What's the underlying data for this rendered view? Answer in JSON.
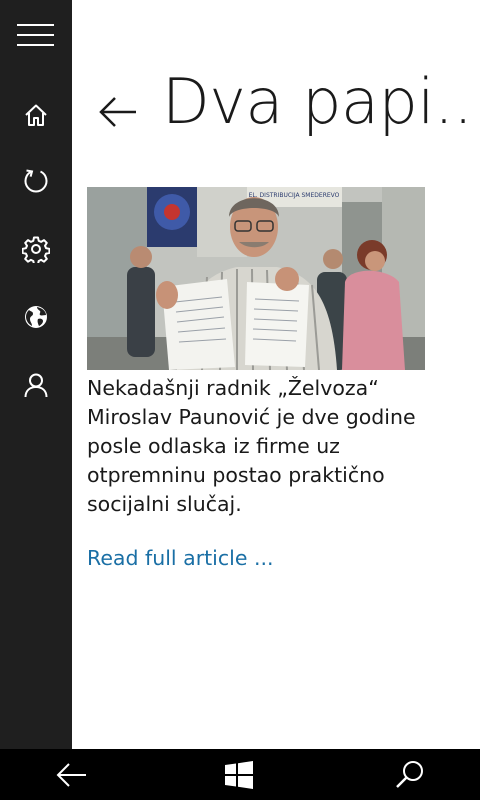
{
  "page": {
    "title": "Dva papi..."
  },
  "article": {
    "summary": "Nekadašnji radnik „Želvoza“ Miroslav Paunović je dve godine posle odlaska iz firme uz otpremninu postao praktično socijalni slučaj.",
    "read_more": "Read full article ...",
    "photo_sign_text": "EL. DISTRIBUCIJA SMEDEREVO"
  },
  "nav_rail": {
    "items": [
      {
        "icon": "menu-icon"
      },
      {
        "icon": "home-icon"
      },
      {
        "icon": "refresh-icon"
      },
      {
        "icon": "gear-icon"
      },
      {
        "icon": "globe-icon"
      },
      {
        "icon": "person-icon"
      }
    ]
  },
  "system_bar": {
    "items": [
      {
        "icon": "back-icon"
      },
      {
        "icon": "windows-icon"
      },
      {
        "icon": "search-icon"
      }
    ]
  },
  "colors": {
    "nav_rail_bg": "#1f1f1f",
    "content_bg": "#ffffff",
    "link": "#1a6fa5",
    "system_bar_bg": "#000000"
  }
}
